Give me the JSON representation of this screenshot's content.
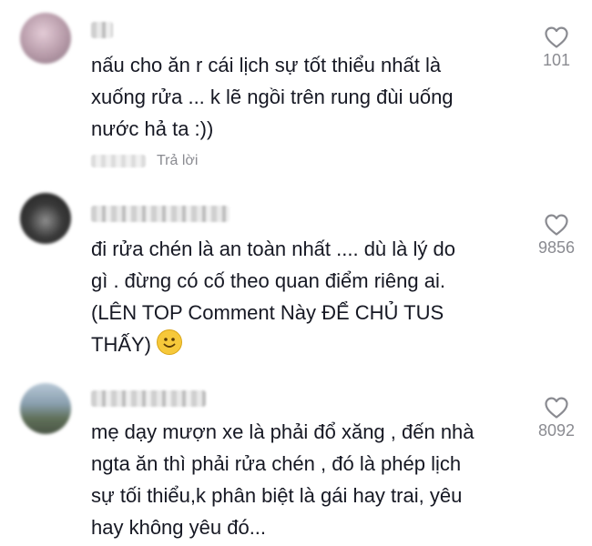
{
  "comments": [
    {
      "text": "nấu cho ăn r cái lịch sự tốt thiểu nhất là\nxuống rửa ... k lẽ ngồi trên rung đùi uống\nnước hả ta :))",
      "likes": "101",
      "reply_label": "Trả lời",
      "avatar_color": "#b69aa8"
    },
    {
      "text_before_emoji": "đi rửa chén là an toàn nhất .... dù là lý do\ngì . đừng có cố theo quan điểm riêng ai.\n(LÊN TOP Comment Này ĐỂ CHỦ TUS\nTHẤY) ",
      "emoji": "slightly-smiling-face",
      "likes": "9856",
      "avatar_color": "#3a3a3a"
    },
    {
      "text": "mẹ dạy mượn xe là phải đổ xăng , đến nhà\nngta ăn thì phải rửa chén , đó là phép lịch\nsự tối thiểu,k phân biệt là gái hay trai, yêu\nhay không yêu đó...",
      "likes": "8092",
      "avatar_color": "#6f7f7a"
    }
  ],
  "icons": {
    "like": "heart-outline-icon"
  },
  "colors": {
    "text": "#161823",
    "muted": "#8a8b91",
    "heart": "#8a8b91"
  }
}
